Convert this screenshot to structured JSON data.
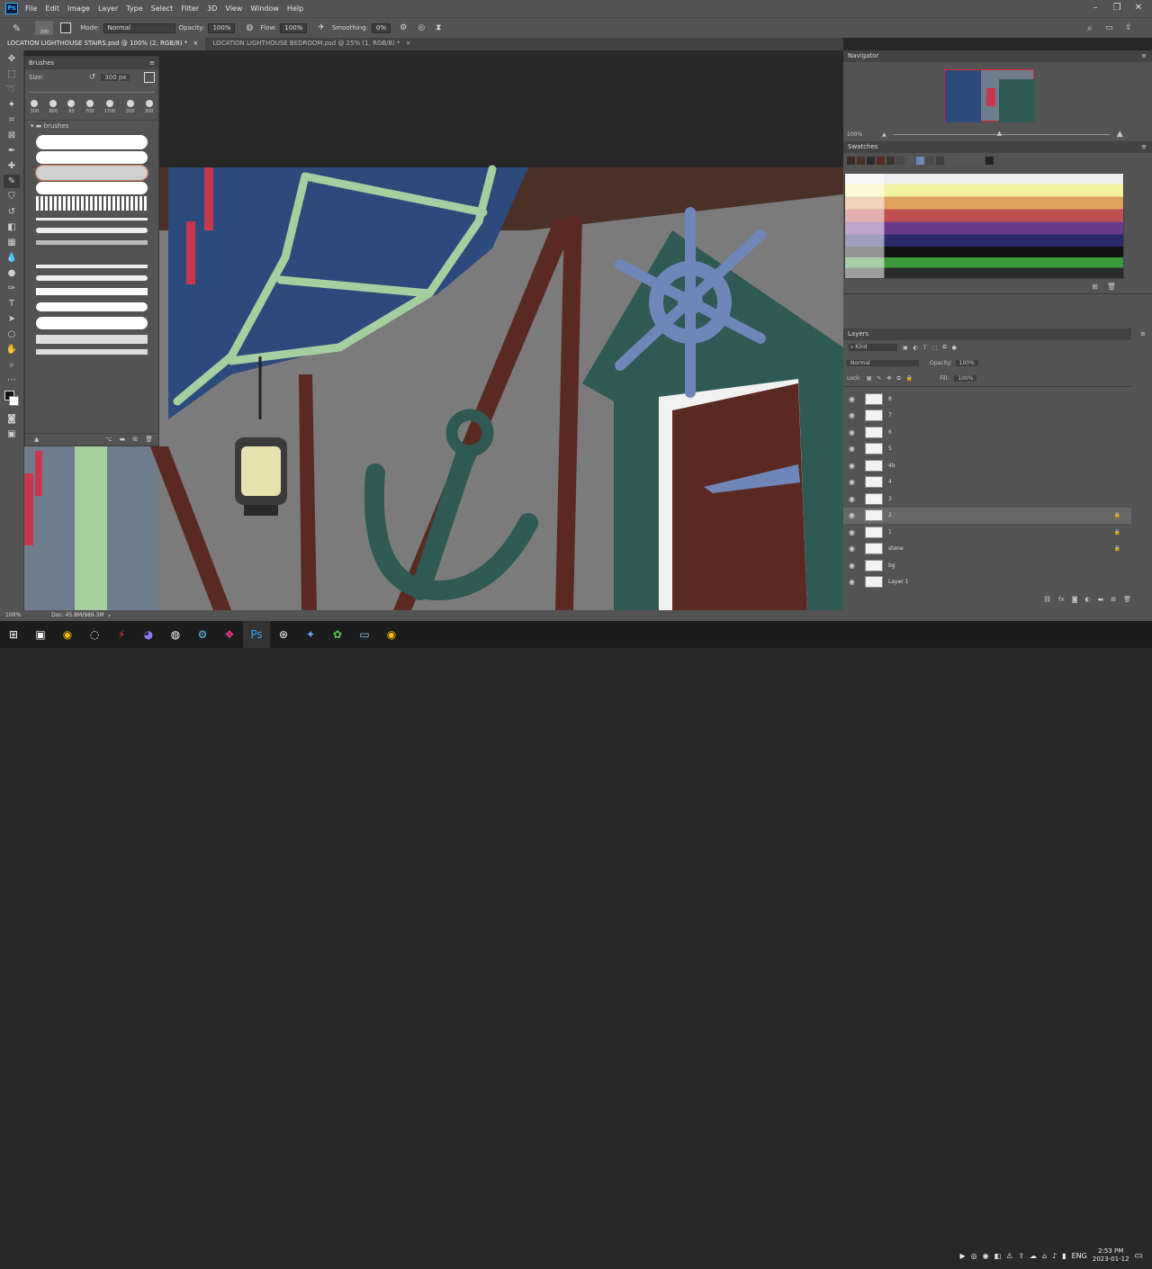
{
  "app": {
    "logo": "Ps"
  },
  "menu": [
    "File",
    "Edit",
    "Image",
    "Layer",
    "Type",
    "Select",
    "Filter",
    "3D",
    "View",
    "Window",
    "Help"
  ],
  "options": {
    "brush_size": "300",
    "mode_label": "Mode:",
    "mode_value": "Normal",
    "opacity_label": "Opacity:",
    "opacity_value": "100%",
    "flow_label": "Flow:",
    "flow_value": "100%",
    "smoothing_label": "Smoothing:",
    "smoothing_value": "0%"
  },
  "tabs": [
    {
      "label": "LOCATION LIGHTHOUSE STAIRS.psd @ 100% (2, RGB/8) *",
      "close": "×"
    },
    {
      "label": "LOCATION LIGHTHOUSE BEDROOM.psd @ 25% (1, RGB/8) *",
      "close": "×"
    }
  ],
  "brushes": {
    "title": "Brushes",
    "size_label": "Size:",
    "size_value": "300 px",
    "presets": [
      "300",
      "800",
      "80",
      "700",
      "1700",
      "200",
      "300"
    ],
    "folder": "brushes"
  },
  "navigator": {
    "title": "Navigator",
    "zoom": "100%"
  },
  "swatches": {
    "title": "Swatches"
  },
  "layers": {
    "title": "Layers",
    "kind_label": "Kind",
    "blend_mode": "Normal",
    "opacity_label": "Opacity:",
    "opacity_value": "100%",
    "lock_label": "Lock:",
    "fill_label": "Fill:",
    "fill_value": "100%",
    "items": [
      "8",
      "7",
      "6",
      "5",
      "4b",
      "4",
      "3",
      "2",
      "1",
      "stone",
      "bg",
      "Layer 1"
    ]
  },
  "status": {
    "zoom": "100%",
    "doc": "Doc: 45.8M/989.3M"
  },
  "taskbar": {
    "lang": "ENG",
    "time": "2:53 PM",
    "date": "2023-01-12"
  },
  "colors": {
    "accent": "#31a8ff",
    "wall": "#7a7a7a",
    "sail": "#2c4a7c",
    "wheel": "#6f86b8",
    "house": "#2f5a54",
    "door": "#5a2a22"
  }
}
